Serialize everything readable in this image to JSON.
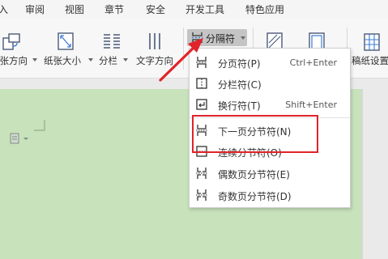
{
  "menu": {
    "items": [
      "插入",
      "审阅",
      "视图",
      "章节",
      "安全",
      "开发工具",
      "特色应用"
    ]
  },
  "ribbon": {
    "items": [
      {
        "label": "纸张方向",
        "icon": "page-orientation-icon"
      },
      {
        "label": "纸张大小",
        "icon": "paper-size-icon"
      },
      {
        "label": "分栏",
        "icon": "columns-icon"
      },
      {
        "label": "文字方向",
        "icon": "text-direction-icon"
      },
      {
        "label": "分隔符",
        "icon": "separator-icon"
      },
      {
        "label": "稿纸设置",
        "icon": "manuscript-grid-icon"
      }
    ]
  },
  "dropdown": {
    "items": [
      {
        "label": "分页符(P)",
        "shortcut": "Ctrl+Enter",
        "icon": "page-break-icon"
      },
      {
        "label": "分栏符(C)",
        "shortcut": "",
        "icon": "column-break-icon"
      },
      {
        "label": "换行符(T)",
        "shortcut": "Shift+Enter",
        "icon": "line-break-icon"
      },
      {
        "label": "下一页分节符(N)",
        "shortcut": "",
        "icon": "next-page-section-break-icon"
      },
      {
        "label": "连续分节符(O)",
        "shortcut": "",
        "icon": "continuous-section-break-icon"
      },
      {
        "label": "偶数页分节符(E)",
        "shortcut": "",
        "icon": "even-page-section-break-icon"
      },
      {
        "label": "奇数页分节符(D)",
        "shortcut": "",
        "icon": "odd-page-section-break-icon"
      }
    ]
  },
  "colors": {
    "highlight_box": "#e2232a",
    "arrow": "#e2232a",
    "page": "#c8e2bc"
  }
}
